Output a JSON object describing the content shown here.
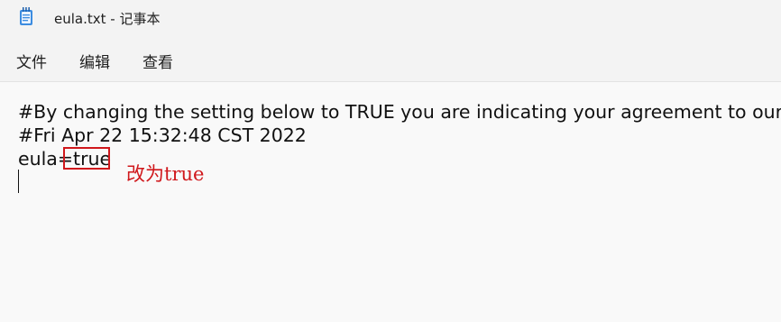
{
  "window": {
    "title": "eula.txt - 记事本",
    "icon": "notepad-icon"
  },
  "menu": {
    "file": "文件",
    "edit": "编辑",
    "view": "查看"
  },
  "document": {
    "line1": "#By changing the setting below to TRUE you are indicating your agreement to our EULA",
    "line2": "#Fri Apr 22 15:32:48 CST 2022",
    "line3_key": "eula=",
    "line3_value": "true"
  },
  "annotation": {
    "text": "改为true",
    "color": "#d0181c"
  }
}
